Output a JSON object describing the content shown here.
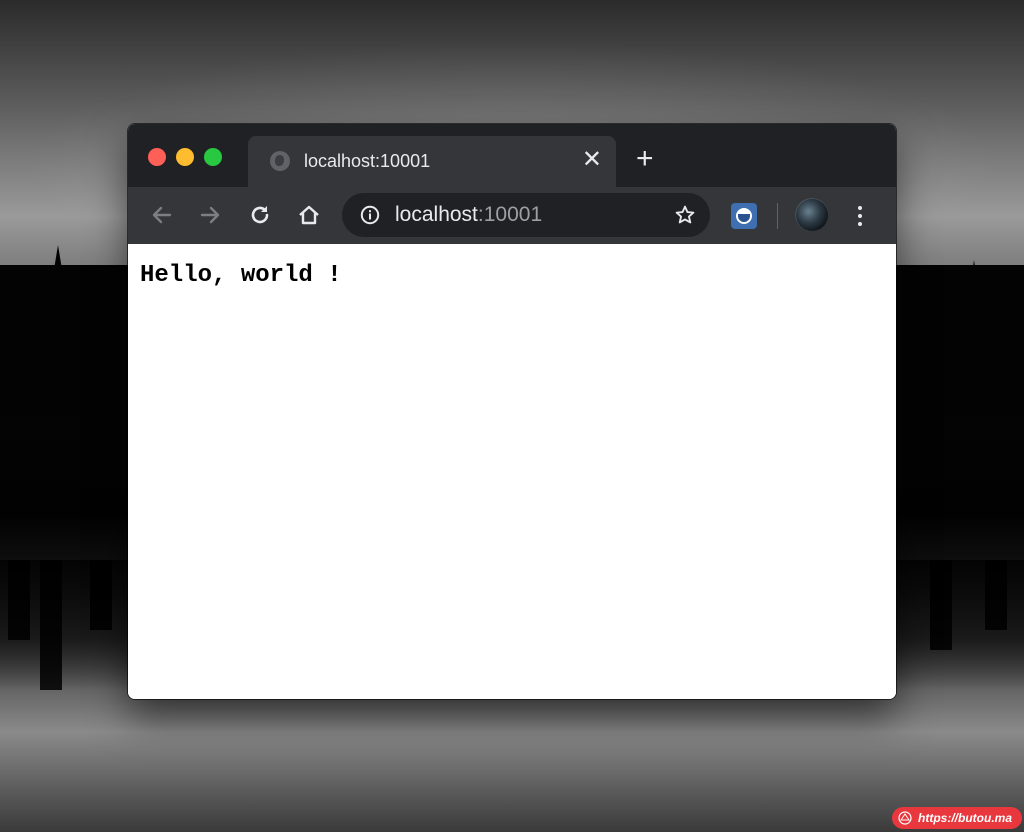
{
  "desktop": {
    "watermark_text": "https://butou.ma"
  },
  "browser": {
    "window_controls": [
      "close",
      "minimize",
      "maximize"
    ],
    "tab": {
      "title": "localhost:10001",
      "favicon": "globe-icon",
      "close_label": "✕"
    },
    "new_tab_label": "+",
    "toolbar": {
      "back": "arrow-left-icon",
      "forward": "arrow-right-icon",
      "reload": "reload-icon",
      "home": "home-icon",
      "address": {
        "host": "localhost",
        "port": ":10001",
        "info_icon": "info-icon",
        "bookmark_icon": "star-icon"
      },
      "extension_icon": "extension-icon",
      "profile_icon": "avatar",
      "menu_icon": "more-vert-icon"
    }
  },
  "page": {
    "text": "Hello, world !"
  },
  "colors": {
    "titlebar": "#202124",
    "toolbar": "#35363a",
    "omnibox": "#202124",
    "close": "#fe5f57",
    "minimize": "#febc2e",
    "maximize": "#28c840",
    "watermark": "#e8373d"
  }
}
